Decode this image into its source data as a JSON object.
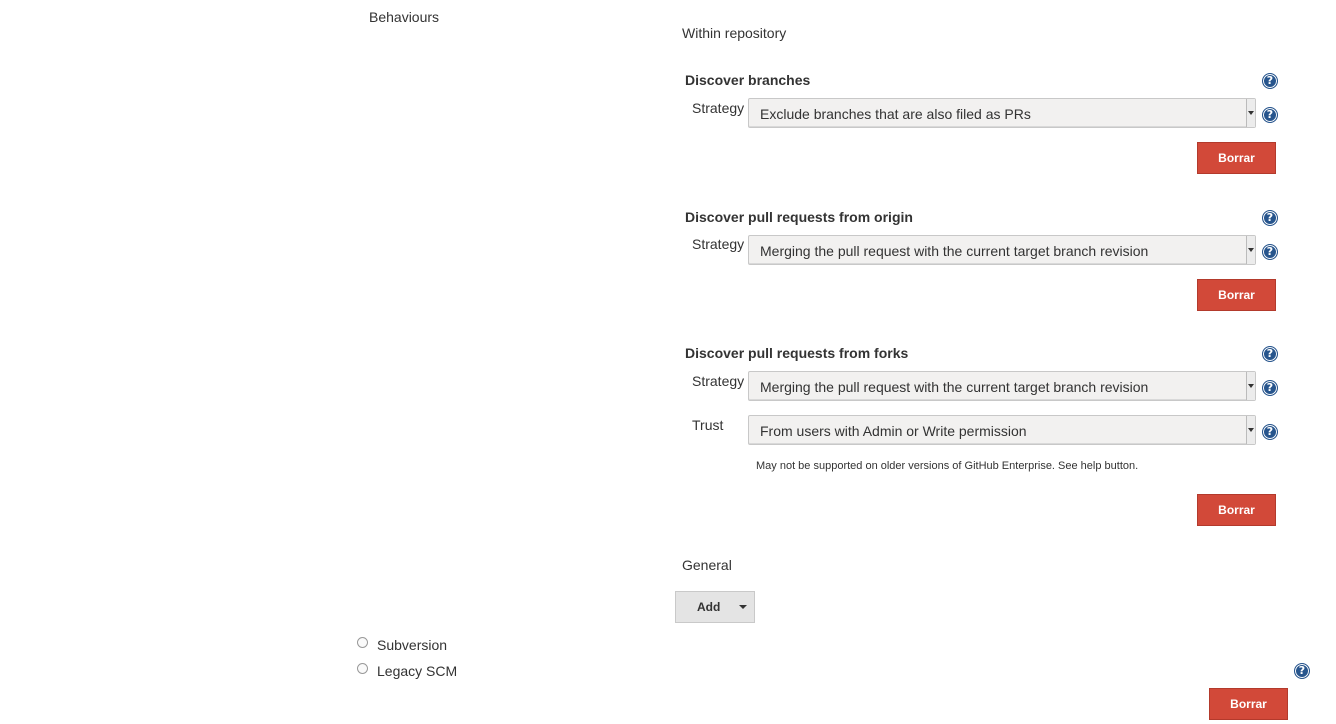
{
  "behaviours_label": "Behaviours",
  "within_repository_label": "Within repository",
  "discover_branches": {
    "title": "Discover branches",
    "strategy_label": "Strategy",
    "strategy_value": "Exclude branches that are also filed as PRs",
    "delete_label": "Borrar"
  },
  "discover_pr_origin": {
    "title": "Discover pull requests from origin",
    "strategy_label": "Strategy",
    "strategy_value": "Merging the pull request with the current target branch revision",
    "delete_label": "Borrar"
  },
  "discover_pr_forks": {
    "title": "Discover pull requests from forks",
    "strategy_label": "Strategy",
    "strategy_value": "Merging the pull request with the current target branch revision",
    "trust_label": "Trust",
    "trust_value": "From users with Admin or Write permission",
    "note": "May not be supported on older versions of GitHub Enterprise. See help button.",
    "delete_label": "Borrar"
  },
  "general_label": "General",
  "add_label": "Add",
  "scm_options": [
    {
      "label": "Subversion",
      "selected": false
    },
    {
      "label": "Legacy SCM",
      "selected": false
    }
  ],
  "bottom_delete_label": "Borrar",
  "colors": {
    "delete_button": "#d24939",
    "help_icon": "#27558d",
    "select_bg": "#f2f1f0",
    "add_button_bg": "#e4e4e4"
  }
}
